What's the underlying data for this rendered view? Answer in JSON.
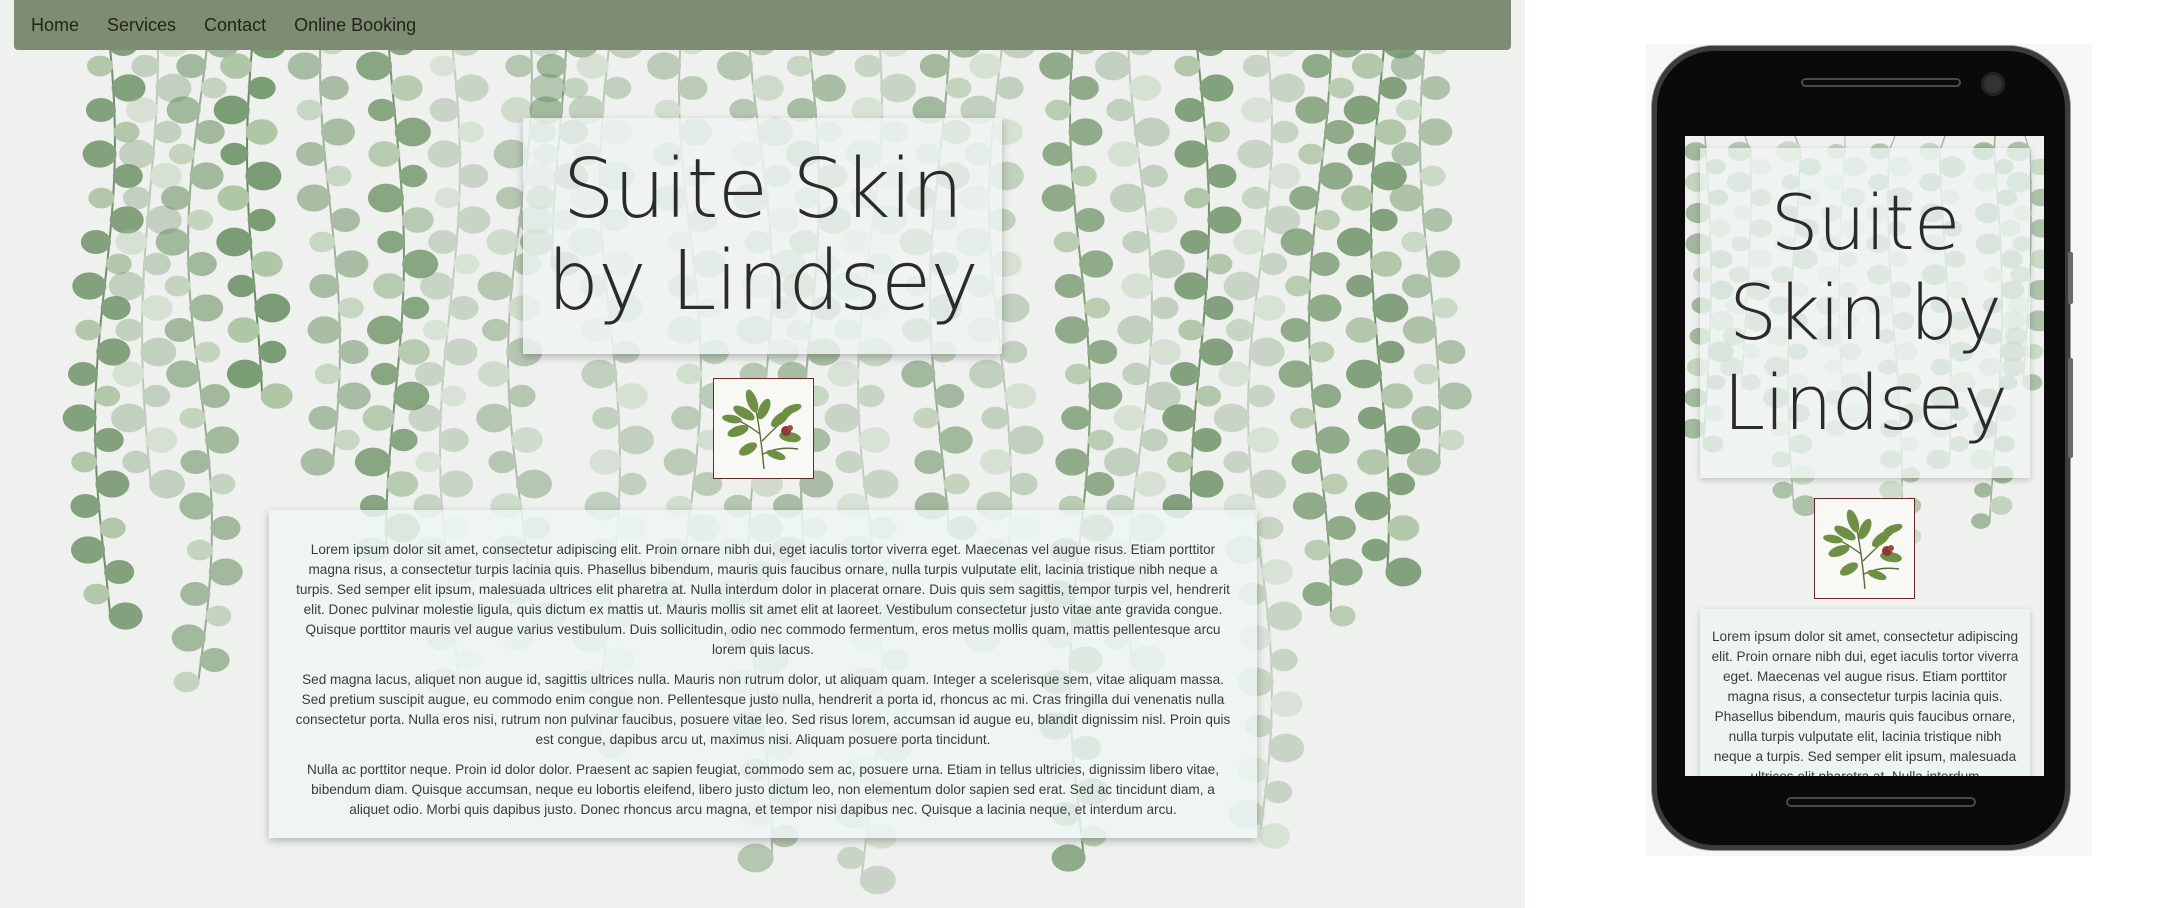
{
  "nav": {
    "items": [
      "Home",
      "Services",
      "Contact",
      "Online Booking"
    ]
  },
  "hero": {
    "title": "Suite Skin by Lindsey"
  },
  "content": {
    "paragraphs": [
      "Lorem ipsum dolor sit amet, consectetur adipiscing elit. Proin ornare nibh dui, eget iaculis tortor viverra eget. Maecenas vel augue risus. Etiam porttitor magna risus, a consectetur turpis lacinia quis. Phasellus bibendum, mauris quis faucibus ornare, nulla turpis vulputate elit, lacinia tristique nibh neque a turpis. Sed semper elit ipsum, malesuada ultrices elit pharetra at. Nulla interdum dolor in placerat ornare. Duis quis sem sagittis, tempor turpis vel, hendrerit elit. Donec pulvinar molestie ligula, quis dictum ex mattis ut. Mauris mollis sit amet elit at laoreet. Vestibulum consectetur justo vitae ante gravida congue. Quisque porttitor mauris vel augue varius vestibulum. Duis sollicitudin, odio nec commodo fermentum, eros metus mollis quam, mattis pellentesque arcu lorem quis lacus.",
      "Sed magna lacus, aliquet non augue id, sagittis ultrices nulla. Mauris non rutrum dolor, ut aliquam quam. Integer a scelerisque sem, vitae aliquam massa. Sed pretium suscipit augue, eu commodo enim congue non. Pellentesque justo nulla, hendrerit a porta id, rhoncus ac mi. Cras fringilla dui venenatis nulla consectetur porta. Nulla eros nisi, rutrum non pulvinar faucibus, posuere vitae leo. Sed risus lorem, accumsan id augue eu, blandit dignissim nisl. Proin quis est congue, dapibus arcu ut, maximus nisi. Aliquam posuere porta tincidunt.",
      "Nulla ac porttitor neque. Proin id dolor dolor. Praesent ac sapien feugiat, commodo sem ac, posuere urna. Etiam in tellus ultricies, dignissim libero vitae, bibendum diam. Quisque accumsan, neque eu lobortis eleifend, libero justo dictum leo, non elementum dolor sapien sed erat. Sed ac tincidunt diam, a aliquet odio. Morbi quis dapibus justo. Donec rhoncus arcu magna, et tempor nisi dapibus nec. Quisque a lacinia neque, et interdum arcu."
    ]
  },
  "mobile": {
    "title": "Suite Skin by Lindsey",
    "paragraph": "Lorem ipsum dolor sit amet, consectetur adipiscing elit. Proin ornare nibh dui, eget iaculis tortor viverra eget. Maecenas vel augue risus. Etiam porttitor magna risus, a consectetur turpis lacinia quis. Phasellus bibendum, mauris quis faucibus ornare, nulla turpis vulputate elit, lacinia tristique nibh neque a turpis. Sed semper elit ipsum, malesuada ultrices elit pharetra at. Nulla interdum"
  },
  "colors": {
    "navbar": "#808b73",
    "background": "#eff1ef",
    "panel": "#eef5f4",
    "leaf_dark": "#6f9468",
    "leaf_light": "#a9c2a0",
    "logo_border": "#6a2a2a"
  },
  "icons": {
    "logo": "plant-sprig-logo"
  }
}
